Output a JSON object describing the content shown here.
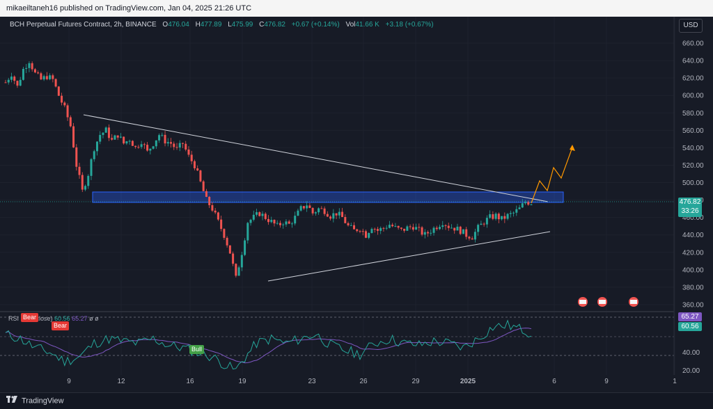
{
  "header": {
    "published_text": "mikaeiltaneh16 published on TradingView.com, Jan 04, 2025 21:26 UTC"
  },
  "legend": {
    "symbol": "BCH Perpetual Futures Contract, 2h, BINANCE",
    "o_label": "O",
    "o_value": "476.04",
    "h_label": "H",
    "h_value": "477.89",
    "l_label": "L",
    "l_value": "475.99",
    "c_label": "C",
    "c_value": "476.82",
    "change": "+0.67 (+0.14%)",
    "vol_label": "Vol",
    "vol_value": "41.66 K",
    "vol_change": "+3.18 (+0.67%)"
  },
  "currency_button": "USD",
  "last_price": {
    "price": "476.82",
    "countdown": "33:26"
  },
  "rsi": {
    "label": "RSI",
    "legend_partial": "close)",
    "value_1": "60.56",
    "value_2": "65.27",
    "extra": "ø  ø",
    "badge_upper": "65.27",
    "badge_lower": "60.56",
    "tags": {
      "bear_1": "Bear",
      "bear_2": "Bear",
      "bear_3": "Bear",
      "bull": "Bull"
    },
    "axis_labels": [
      "40.00",
      "20.00"
    ]
  },
  "footer": {
    "brand": "TradingView"
  },
  "colors": {
    "bull": "#26a69a",
    "bear": "#ef5350",
    "zone": "#2962ff",
    "trendline": "#d1d4dc",
    "projection": "#ff9800",
    "rsi_line": "#26a69a",
    "rsi_ma": "#7e57c2"
  },
  "chart_data": {
    "type": "candlestick",
    "y_axis_labels": [
      "660.00",
      "640.00",
      "620.00",
      "600.00",
      "580.00",
      "560.00",
      "540.00",
      "520.00",
      "500.00",
      "480.00",
      "460.00",
      "440.00",
      "420.00",
      "400.00",
      "380.00",
      "360.00"
    ],
    "x_axis_labels": [
      "9",
      "12",
      "16",
      "19",
      "23",
      "26",
      "29",
      "2025",
      "6",
      "9",
      "1"
    ],
    "ylim": [
      360,
      665
    ],
    "price_path": [
      [
        0,
        615
      ],
      [
        2,
        625
      ],
      [
        4,
        610
      ],
      [
        6,
        630
      ],
      [
        8,
        640
      ],
      [
        10,
        625
      ],
      [
        12,
        618
      ],
      [
        14,
        622
      ],
      [
        16,
        618
      ],
      [
        18,
        600
      ],
      [
        20,
        585
      ],
      [
        22,
        565
      ],
      [
        24,
        520
      ],
      [
        26,
        490
      ],
      [
        28,
        510
      ],
      [
        30,
        540
      ],
      [
        32,
        555
      ],
      [
        34,
        560
      ],
      [
        36,
        548
      ],
      [
        38,
        555
      ],
      [
        40,
        545
      ],
      [
        42,
        550
      ],
      [
        44,
        540
      ],
      [
        46,
        548
      ],
      [
        48,
        535
      ],
      [
        50,
        545
      ],
      [
        52,
        555
      ],
      [
        54,
        548
      ],
      [
        56,
        545
      ],
      [
        58,
        538
      ],
      [
        60,
        545
      ],
      [
        62,
        530
      ],
      [
        64,
        520
      ],
      [
        66,
        500
      ],
      [
        68,
        480
      ],
      [
        70,
        470
      ],
      [
        72,
        455
      ],
      [
        74,
        440
      ],
      [
        76,
        420
      ],
      [
        78,
        390
      ],
      [
        80,
        420
      ],
      [
        82,
        455
      ],
      [
        84,
        460
      ],
      [
        86,
        465
      ],
      [
        88,
        460
      ],
      [
        90,
        455
      ],
      [
        92,
        450
      ],
      [
        94,
        455
      ],
      [
        96,
        452
      ],
      [
        98,
        460
      ],
      [
        100,
        470
      ],
      [
        102,
        475
      ],
      [
        104,
        465
      ],
      [
        106,
        470
      ],
      [
        108,
        468
      ],
      [
        110,
        462
      ],
      [
        112,
        465
      ],
      [
        114,
        460
      ],
      [
        116,
        450
      ],
      [
        118,
        445
      ],
      [
        120,
        448
      ],
      [
        122,
        440
      ],
      [
        124,
        450
      ],
      [
        126,
        445
      ],
      [
        128,
        448
      ],
      [
        130,
        452
      ],
      [
        132,
        448
      ],
      [
        134,
        445
      ],
      [
        136,
        448
      ],
      [
        138,
        450
      ],
      [
        140,
        445
      ],
      [
        142,
        440
      ],
      [
        144,
        445
      ],
      [
        146,
        450
      ],
      [
        148,
        455
      ],
      [
        150,
        450
      ],
      [
        152,
        448
      ],
      [
        154,
        445
      ],
      [
        156,
        440
      ],
      [
        158,
        438
      ],
      [
        160,
        448
      ],
      [
        162,
        455
      ],
      [
        164,
        460
      ],
      [
        166,
        462
      ],
      [
        168,
        458
      ],
      [
        170,
        462
      ],
      [
        172,
        465
      ],
      [
        174,
        470
      ],
      [
        176,
        478
      ],
      [
        178,
        477
      ]
    ],
    "rsi_ylim": [
      15,
      85
    ],
    "rsi_path": [
      [
        0,
        60
      ],
      [
        5,
        55
      ],
      [
        10,
        45
      ],
      [
        15,
        40
      ],
      [
        20,
        30
      ],
      [
        25,
        35
      ],
      [
        30,
        50
      ],
      [
        35,
        55
      ],
      [
        40,
        52
      ],
      [
        45,
        50
      ],
      [
        50,
        55
      ],
      [
        55,
        48
      ],
      [
        60,
        45
      ],
      [
        65,
        40
      ],
      [
        70,
        35
      ],
      [
        75,
        25
      ],
      [
        78,
        20
      ],
      [
        80,
        30
      ],
      [
        85,
        50
      ],
      [
        90,
        55
      ],
      [
        95,
        50
      ],
      [
        100,
        55
      ],
      [
        105,
        60
      ],
      [
        110,
        48
      ],
      [
        115,
        42
      ],
      [
        120,
        38
      ],
      [
        125,
        50
      ],
      [
        130,
        55
      ],
      [
        135,
        50
      ],
      [
        140,
        48
      ],
      [
        145,
        52
      ],
      [
        150,
        50
      ],
      [
        155,
        45
      ],
      [
        160,
        55
      ],
      [
        165,
        68
      ],
      [
        170,
        70
      ],
      [
        175,
        65
      ],
      [
        178,
        61
      ]
    ],
    "zone": [
      478,
      490
    ],
    "trendlines": [
      {
        "from": [
          22,
          580
        ],
        "to": [
          180,
          478
        ]
      },
      {
        "from": [
          78,
          388
        ],
        "to": [
          180,
          445
        ]
      }
    ],
    "projection": [
      [
        178,
        477
      ],
      [
        182,
        500
      ],
      [
        185,
        490
      ],
      [
        188,
        520
      ],
      [
        191,
        505
      ],
      [
        196,
        542
      ]
    ]
  }
}
